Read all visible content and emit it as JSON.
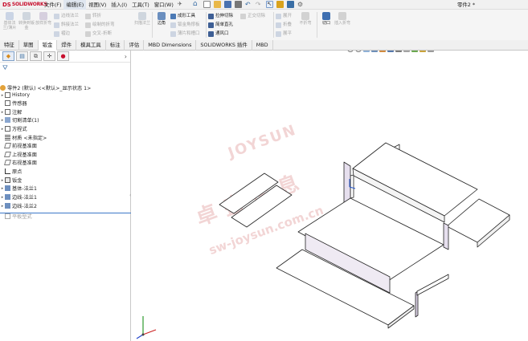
{
  "app": {
    "logo": "SOLIDWORKS",
    "logo_mark": "DS",
    "doc_title": "零件2 *"
  },
  "menu": [
    {
      "label": "文件(F)"
    },
    {
      "label": "编辑(E)",
      "active": true
    },
    {
      "label": "视图(V)"
    },
    {
      "label": "插入(I)"
    },
    {
      "label": "工具(T)"
    },
    {
      "label": "窗口(W)"
    }
  ],
  "ribbon": {
    "big": [
      {
        "label": "基体法兰/薄片"
      },
      {
        "label": "转换到钣金"
      },
      {
        "label": "放样折弯"
      }
    ],
    "small_col1": [
      {
        "label": "边线法兰"
      },
      {
        "label": "斜接法兰"
      },
      {
        "label": "褶边"
      }
    ],
    "small_col2": [
      {
        "label": "转折"
      },
      {
        "label": "绘制的折弯"
      },
      {
        "label": "交叉-折断"
      }
    ],
    "big2": {
      "label": "扫描法兰"
    },
    "corners": {
      "label": "边角"
    },
    "forming": [
      {
        "label": "成形工具"
      },
      {
        "label": "钣金角撑板"
      },
      {
        "label": "薄片和槽口"
      }
    ],
    "holes": [
      {
        "label": "拉伸切除"
      },
      {
        "label": "简单直孔"
      },
      {
        "label": "通风口"
      }
    ],
    "normal_cut": {
      "label": "正交切除"
    },
    "unfold": [
      {
        "label": "展开"
      },
      {
        "label": "折叠"
      },
      {
        "label": "展平"
      }
    ],
    "no_bends": {
      "label": "不折弯"
    },
    "rip": {
      "label": "切口"
    },
    "insert_bends": {
      "label": "插入折弯"
    }
  },
  "tabs": [
    {
      "label": "特征"
    },
    {
      "label": "草图"
    },
    {
      "label": "钣金",
      "active": true
    },
    {
      "label": "焊件"
    },
    {
      "label": "模具工具"
    },
    {
      "label": "标注"
    },
    {
      "label": "评估"
    },
    {
      "label": "MBD Dimensions"
    },
    {
      "label": "SOLIDWORKS 插件"
    },
    {
      "label": "MBD"
    }
  ],
  "feature_tree": {
    "root": "零件2 (默认) <<默认>_显示状态 1>",
    "items": [
      {
        "label": "History",
        "icon": "folder-icon",
        "expandable": true
      },
      {
        "label": "传感器",
        "icon": "sensor-icon"
      },
      {
        "label": "注解",
        "icon": "annotation-icon",
        "expandable": true
      },
      {
        "label": "切割清单(1)",
        "icon": "cutlist-icon",
        "expandable": true
      },
      {
        "label": "方程式",
        "icon": "equation-icon",
        "expandable": true
      },
      {
        "label": "材质 <未指定>",
        "icon": "material-icon"
      },
      {
        "label": "前视基准面",
        "icon": "plane-icon"
      },
      {
        "label": "上视基准面",
        "icon": "plane-icon"
      },
      {
        "label": "右视基准面",
        "icon": "plane-icon"
      },
      {
        "label": "原点",
        "icon": "origin-icon"
      },
      {
        "label": "钣金",
        "icon": "sheetmetal-icon",
        "expandable": true
      },
      {
        "label": "基体-法兰1",
        "icon": "base-flange-icon",
        "expandable": true
      },
      {
        "label": "边线-法兰1",
        "icon": "edge-flange-icon",
        "expandable": true
      },
      {
        "label": "边线-法兰2",
        "icon": "edge-flange-icon",
        "expandable": true
      },
      {
        "label": "平板型式",
        "icon": "flat-pattern-icon",
        "faded": true
      }
    ]
  },
  "watermark": {
    "en": "JOYSUN",
    "cn": "卓盛信息",
    "url": "sw-joysun.com.cn"
  },
  "colors": {
    "accent": "#3c78c8",
    "brand": "#c8102e",
    "part_face": "#ffffff",
    "part_inner_shadow": "#cdbfd6",
    "edge": "#222222"
  }
}
